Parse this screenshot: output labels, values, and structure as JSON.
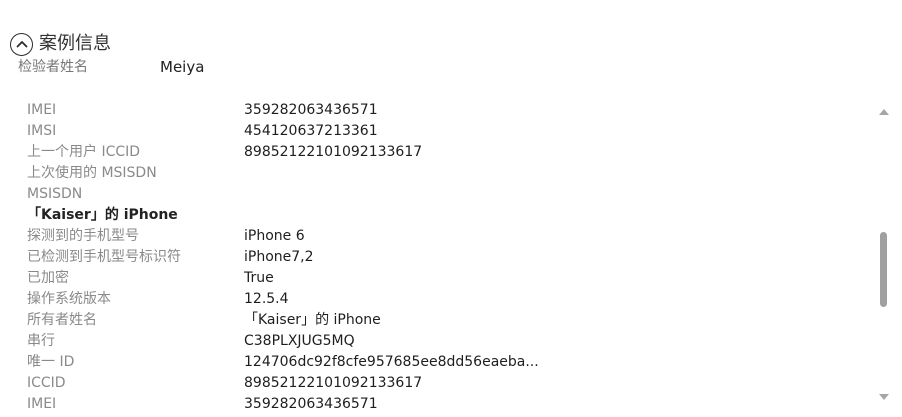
{
  "section": {
    "title": "案例信息",
    "toggle_icon": "chevron-up-circle-icon"
  },
  "examiner": {
    "label": "检验者姓名",
    "value": "Meiya"
  },
  "details": {
    "rows": [
      {
        "label": "IMEI",
        "value": "359282063436571"
      },
      {
        "label": "IMSI",
        "value": "454120637213361"
      },
      {
        "label": "上一个用户 ICCID",
        "value": "89852122101092133617"
      },
      {
        "label": "上次使用的 MSISDN",
        "value": ""
      },
      {
        "label": "MSISDN",
        "value": ""
      },
      {
        "label": "「Kaiser」的 iPhone",
        "value": ""
      },
      {
        "label": "探测到的手机型号",
        "value": "iPhone 6"
      },
      {
        "label": "已检测到手机型号标识符",
        "value": "iPhone7,2"
      },
      {
        "label": "已加密",
        "value": "True"
      },
      {
        "label": "操作系统版本",
        "value": "12.5.4"
      },
      {
        "label": "所有者姓名",
        "value": "「Kaiser」的 iPhone"
      },
      {
        "label": "串行",
        "value": "C38PLXJUG5MQ"
      },
      {
        "label": "唯一 ID",
        "value": "124706dc92f8cfe957685ee8dd56eaeba..."
      },
      {
        "label": "ICCID",
        "value": "89852122101092133617"
      },
      {
        "label": "IMEI",
        "value": "359282063436571"
      }
    ]
  },
  "scrollbar": {
    "up_icon": "scroll-up-arrow-icon",
    "down_icon": "scroll-down-arrow-icon"
  }
}
